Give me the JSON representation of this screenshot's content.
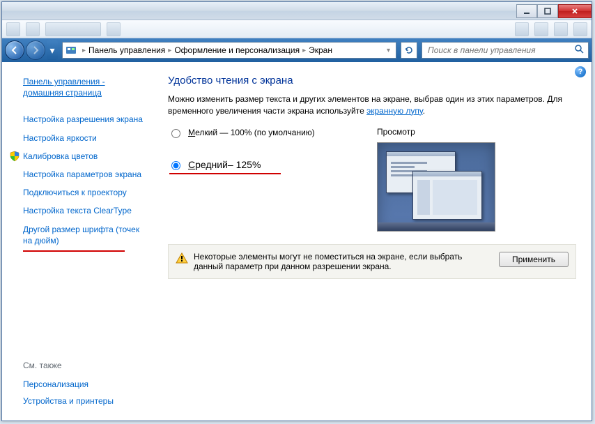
{
  "window": {
    "minimize": "−",
    "maximize": "□",
    "close": "✕"
  },
  "breadcrumb": {
    "items": [
      "Панель управления",
      "Оформление и персонализация",
      "Экран"
    ]
  },
  "search": {
    "placeholder": "Поиск в панели управления"
  },
  "sidebar": {
    "home": "Панель управления - домашняя страница",
    "items": [
      "Настройка разрешения экрана",
      "Настройка яркости",
      "Калибровка цветов",
      "Настройка параметров экрана",
      "Подключиться к проектору",
      "Настройка текста ClearType",
      "Другой размер шрифта (точек на дюйм)"
    ],
    "see_also_header": "См. также",
    "see_also": [
      "Персонализация",
      "Устройства и принтеры"
    ]
  },
  "main": {
    "title": "Удобство чтения с экрана",
    "desc_prefix": "Можно изменить размер текста и других элементов на экране, выбрав один из этих параметров. Для временного увеличения части экрана используйте ",
    "desc_link": "экранную лупу",
    "desc_suffix": ".",
    "radio_small_prefix": "М",
    "radio_small_rest": "елкий — 100% (по умолчанию)",
    "radio_medium_prefix": "С",
    "radio_medium_rest": "редний– 125%",
    "preview_label": "Просмотр",
    "warning": "Некоторые элементы могут не поместиться на экране, если выбрать данный параметр при данном разрешении экрана.",
    "apply": "Применить"
  }
}
